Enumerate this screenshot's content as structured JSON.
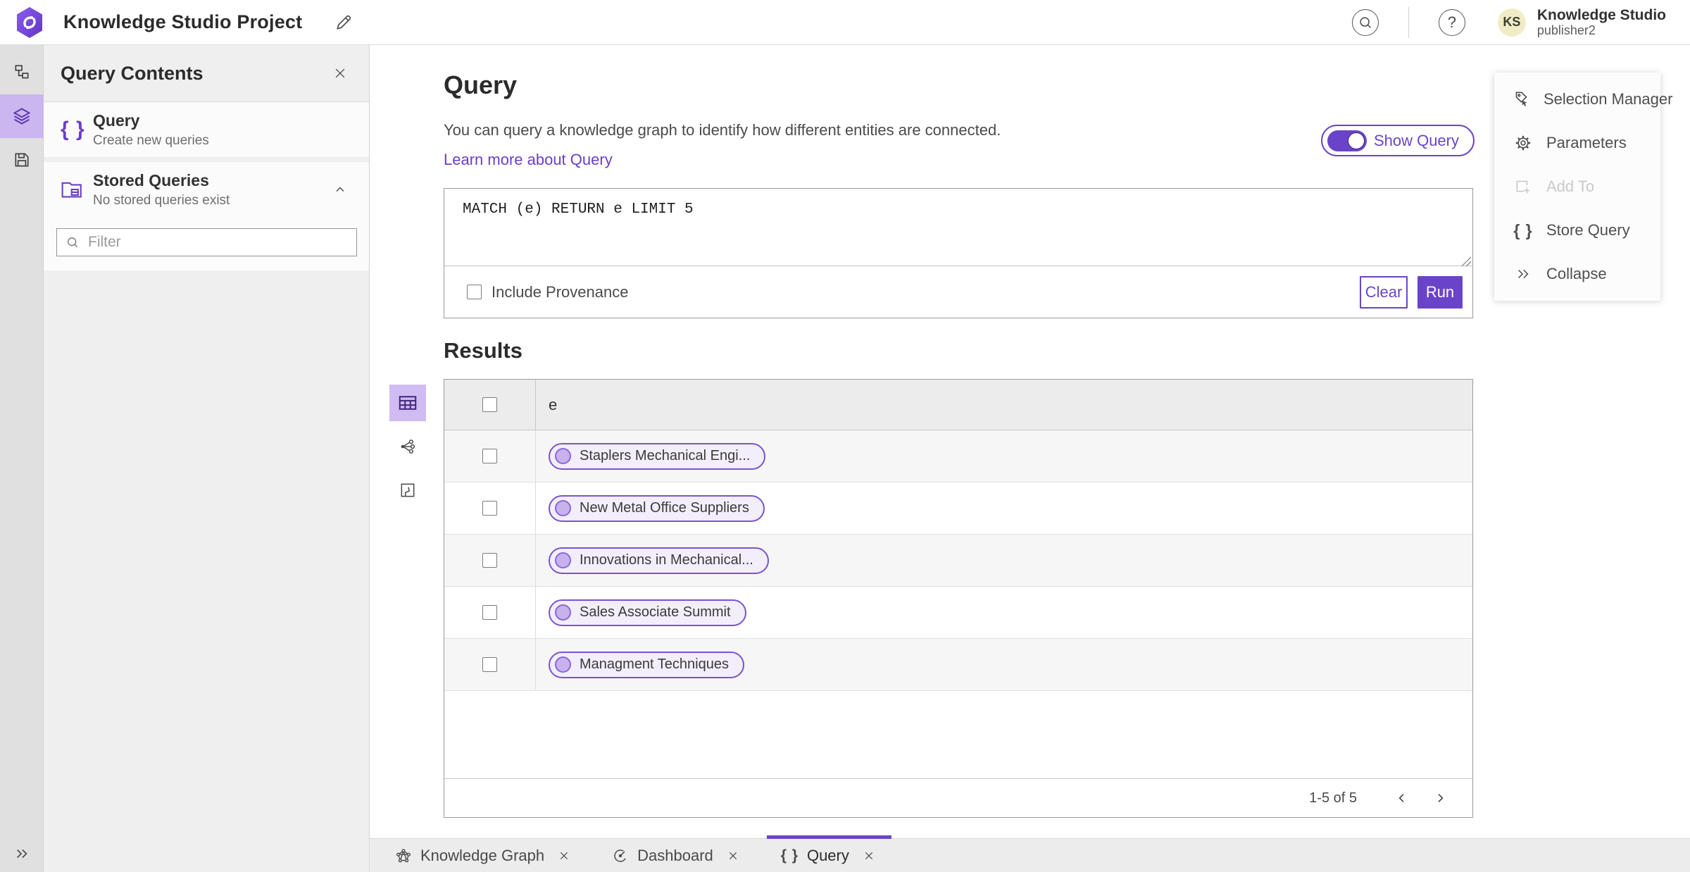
{
  "header": {
    "app_title": "Knowledge Studio Project",
    "user": {
      "initials": "KS",
      "name": "Knowledge Studio",
      "role": "publisher2"
    }
  },
  "contents_panel": {
    "title": "Query Contents",
    "query_item": {
      "title": "Query",
      "subtitle": "Create new queries"
    },
    "stored_item": {
      "title": "Stored Queries",
      "subtitle": "No stored queries exist"
    },
    "filter_placeholder": "Filter"
  },
  "query_section": {
    "heading": "Query",
    "description": "You can query a knowledge graph to identify how different entities are connected.",
    "learn_more_label": "Learn more about Query",
    "show_query_label": "Show Query",
    "query_text": "MATCH (e) RETURN e LIMIT 5",
    "include_provenance_label": "Include Provenance",
    "clear_label": "Clear",
    "run_label": "Run"
  },
  "results": {
    "heading": "Results",
    "column_header": "e",
    "rows": [
      {
        "label": "Staplers Mechanical Engi..."
      },
      {
        "label": "New Metal Office Suppliers"
      },
      {
        "label": "Innovations in Mechanical..."
      },
      {
        "label": "Sales Associate Summit"
      },
      {
        "label": "Managment Techniques"
      }
    ],
    "pagination_label": "1-5 of 5"
  },
  "tools_panel": {
    "items": [
      {
        "label": "Selection Manager",
        "disabled": false
      },
      {
        "label": "Parameters",
        "disabled": false
      },
      {
        "label": "Add To",
        "disabled": true
      },
      {
        "label": "Store Query",
        "disabled": false
      },
      {
        "label": "Collapse",
        "disabled": false
      }
    ]
  },
  "tabs": [
    {
      "label": "Knowledge Graph",
      "active": false
    },
    {
      "label": "Dashboard",
      "active": false
    },
    {
      "label": "Query",
      "active": true
    }
  ],
  "glyphs": {
    "braces": "{ }",
    "help": "?"
  },
  "colors": {
    "accent": "#6a44c8",
    "accent_light": "#cfbcf2",
    "rail_selected": "#cbb6ef",
    "pill_bg": "#f2eefb",
    "pill_border": "#7a54cf",
    "avatar_bg": "#f0edc6",
    "panel_bg": "#efefef",
    "table_header_bg": "#ececec"
  }
}
